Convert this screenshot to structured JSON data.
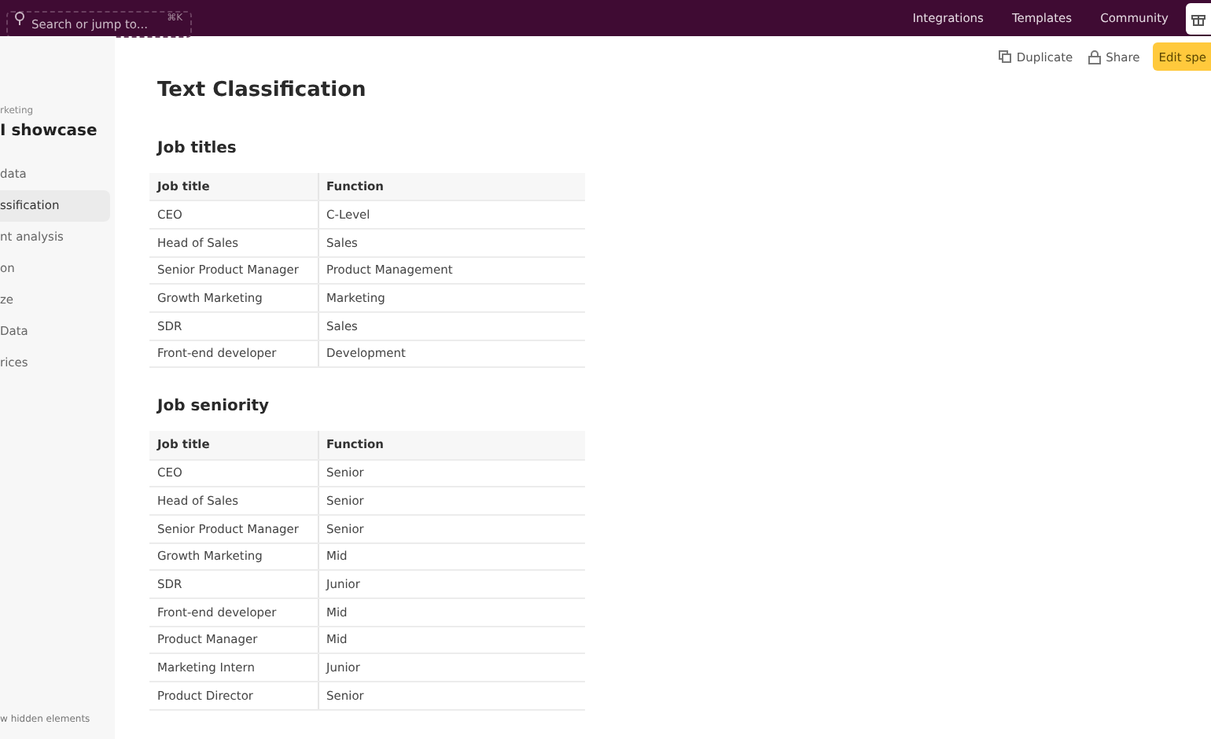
{
  "top_bar": {
    "search": {
      "placeholder": "Search or jump to...",
      "shortcut": "⌘K"
    },
    "links": [
      "Integrations",
      "Templates",
      "Community"
    ]
  },
  "sidebar": {
    "workspace": "rketing",
    "title": "I showcase",
    "items": [
      {
        "label": "data",
        "selected": false
      },
      {
        "label": "ssification",
        "selected": true
      },
      {
        "label": "nt analysis",
        "selected": false
      },
      {
        "label": "on",
        "selected": false
      },
      {
        "label": "ze",
        "selected": false
      },
      {
        "label": "Data",
        "selected": false
      },
      {
        "label": "rices",
        "selected": false
      }
    ],
    "footer": "w hidden elements"
  },
  "actions": {
    "duplicate": "Duplicate",
    "share": "Share",
    "edit": "Edit spe"
  },
  "page": {
    "title": "Text Classification",
    "sections": [
      {
        "heading": "Job titles",
        "columns": [
          "Job title",
          "Function"
        ],
        "rows": [
          [
            "CEO",
            "C-Level"
          ],
          [
            "Head of Sales",
            "Sales"
          ],
          [
            "Senior Product Manager",
            "Product Management"
          ],
          [
            "Growth Marketing",
            "Marketing"
          ],
          [
            "SDR",
            "Sales"
          ],
          [
            "Front-end developer",
            "Development"
          ]
        ]
      },
      {
        "heading": "Job seniority",
        "columns": [
          "Job title",
          "Function"
        ],
        "rows": [
          [
            "CEO",
            "Senior"
          ],
          [
            "Head of Sales",
            "Senior"
          ],
          [
            "Senior Product Manager",
            "Senior"
          ],
          [
            "Growth Marketing",
            "Mid"
          ],
          [
            "SDR",
            "Junior"
          ],
          [
            "Front-end developer",
            "Mid"
          ],
          [
            "Product Manager",
            "Mid"
          ],
          [
            "Marketing Intern",
            "Junior"
          ],
          [
            "Product Director",
            "Senior"
          ]
        ]
      }
    ]
  }
}
